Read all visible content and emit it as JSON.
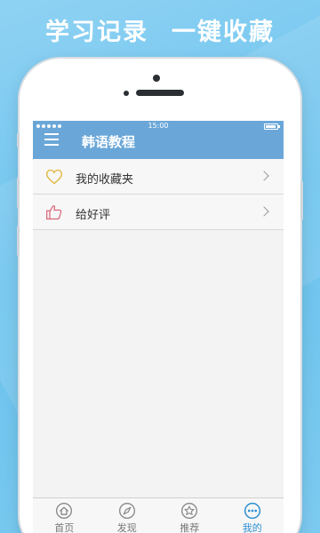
{
  "promo": {
    "part1": "学习记录",
    "part2": "一键收藏"
  },
  "status_bar": {
    "time": "15:00"
  },
  "header": {
    "title": "韩语教程",
    "menu_icon": "hamburger-menu-icon"
  },
  "list": [
    {
      "label": "我的收藏夹",
      "icon": "heart-outline-icon"
    },
    {
      "label": "给好评",
      "icon": "thumbs-up-icon"
    }
  ],
  "tabbar": {
    "active": "我的",
    "tabs": [
      {
        "label": "首页",
        "icon": "home-icon"
      },
      {
        "label": "发现",
        "icon": "compass-icon"
      },
      {
        "label": "推荐",
        "icon": "star-icon"
      },
      {
        "label": "我的",
        "icon": "more-dots-icon"
      }
    ]
  },
  "colors": {
    "background": "#7ccaf0",
    "header": "#6aa7d8",
    "active_tab": "#2b8fd1",
    "heart": "#e0b437",
    "thumbs_up": "#d9687a"
  }
}
